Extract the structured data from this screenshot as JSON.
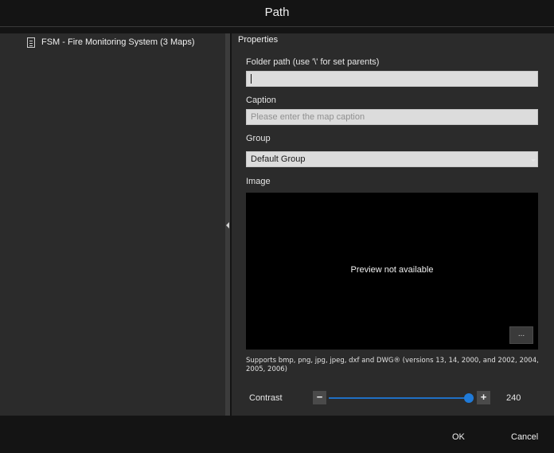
{
  "window": {
    "title": "Path"
  },
  "tree": {
    "items": [
      {
        "label": "FSM - Fire Monitoring System (3 Maps)",
        "icon": "map-document-icon"
      }
    ]
  },
  "properties": {
    "section_title": "Properties",
    "folder_path": {
      "label": "Folder path (use '\\' for set parents)",
      "value": ""
    },
    "caption": {
      "label": "Caption",
      "placeholder": "Please enter the map caption",
      "value": ""
    },
    "group": {
      "label": "Group",
      "value": "Default Group"
    },
    "image": {
      "label": "Image",
      "preview_message": "Preview not available",
      "browse_label": "...",
      "supports_text": "Supports bmp, png, jpg, jpeg, dxf and DWG® (versions 13, 14, 2000, and 2002, 2004, 2005, 2006)"
    },
    "contrast": {
      "label": "Contrast",
      "minus_label": "−",
      "plus_label": "+",
      "value": "240",
      "fraction": 1.0,
      "accent_color": "#1f7ad8"
    }
  },
  "footer": {
    "ok_label": "OK",
    "cancel_label": "Cancel"
  }
}
